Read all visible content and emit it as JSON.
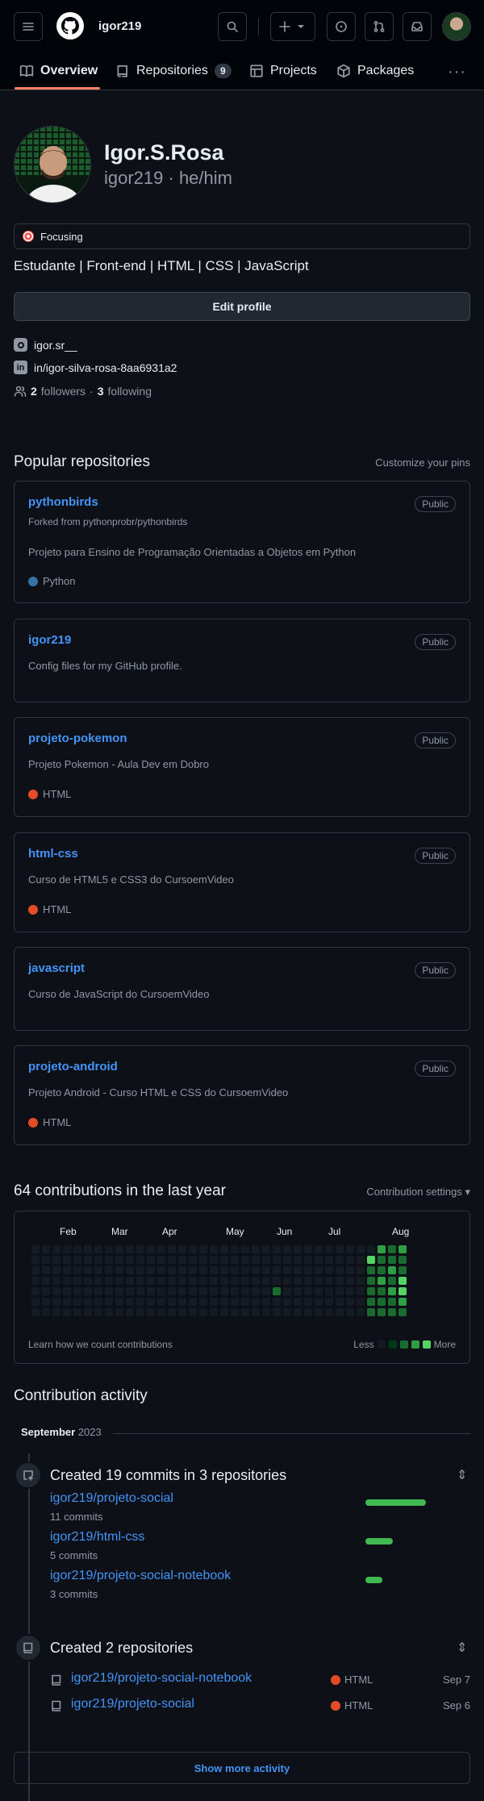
{
  "header": {
    "username": "igor219",
    "tabs": [
      {
        "label": "Overview"
      },
      {
        "label": "Repositories",
        "count": "9"
      },
      {
        "label": "Projects"
      },
      {
        "label": "Packages"
      }
    ]
  },
  "profile": {
    "name": "Igor.S.Rosa",
    "login_pronouns": "igor219 · he/him",
    "status": "Focusing",
    "bio": "Estudante | Front-end | HTML | CSS | JavaScript",
    "edit_label": "Edit profile",
    "instagram": "igor.sr__",
    "linkedin": "in/igor-silva-rosa-8aa6931a2",
    "followers_count": "2",
    "followers_label": "followers",
    "separator": "·",
    "following_count": "3",
    "following_label": "following"
  },
  "popular": {
    "title": "Popular repositories",
    "customize": "Customize your pins",
    "repos": [
      {
        "name": "pythonbirds",
        "visibility": "Public",
        "forked": "Forked from pythonprobr/pythonbirds",
        "desc": "Projeto para Ensino de Programação Orientadas a Objetos em Python",
        "lang": "Python",
        "lang_color": "#3572A5"
      },
      {
        "name": "igor219",
        "visibility": "Public",
        "desc": "Config files for my GitHub profile."
      },
      {
        "name": "projeto-pokemon",
        "visibility": "Public",
        "desc": "Projeto Pokemon - Aula Dev em Dobro",
        "lang": "HTML",
        "lang_color": "#e34c26"
      },
      {
        "name": "html-css",
        "visibility": "Public",
        "desc": "Curso de HTML5 e CSS3 do CursoemVideo",
        "lang": "HTML",
        "lang_color": "#e34c26"
      },
      {
        "name": "javascript",
        "visibility": "Public",
        "desc": "Curso de JavaScript do CursoemVideo"
      },
      {
        "name": "projeto-android",
        "visibility": "Public",
        "desc": "Projeto Android - Curso HTML e CSS do CursoemVideo",
        "lang": "HTML",
        "lang_color": "#e34c26"
      }
    ]
  },
  "contributions": {
    "title": "64 contributions in the last year",
    "settings": "Contribution settings ▾",
    "months": [
      "Feb",
      "Mar",
      "Apr",
      "May",
      "Jun",
      "Jul",
      "Aug"
    ],
    "learn": "Learn how we count contributions",
    "less": "Less",
    "more": "More",
    "legend_colors": [
      "#151b23",
      "#033a16",
      "#196c2e",
      "#2ea043",
      "#56d364"
    ]
  },
  "activity": {
    "title": "Contribution activity",
    "month": "September",
    "year": "2023",
    "commits_title": "Created 19 commits in 3 repositories",
    "commit_repos": [
      {
        "repo": "igor219/projeto-social",
        "commits": "11 commits",
        "share": 0.58
      },
      {
        "repo": "igor219/html-css",
        "commits": "5 commits",
        "share": 0.26
      },
      {
        "repo": "igor219/projeto-social-notebook",
        "commits": "3 commits",
        "share": 0.16
      }
    ],
    "created_title": "Created 2 repositories",
    "created_repos": [
      {
        "repo": "igor219/projeto-social-notebook",
        "lang": "HTML",
        "date": "Sep 7"
      },
      {
        "repo": "igor219/projeto-social",
        "lang": "HTML",
        "date": "Sep 6"
      }
    ],
    "show_more": "Show more activity"
  }
}
